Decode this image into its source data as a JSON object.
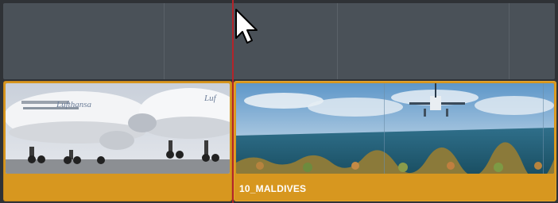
{
  "timeline": {
    "clips": [
      {
        "label": ""
      },
      {
        "label": "10_MALDIVES"
      }
    ]
  },
  "icons": {
    "cursor": "arrow-pointer-icon"
  },
  "colors": {
    "clip_fill": "#d7971f",
    "track_bg": "#4a5158",
    "playhead": "#b3242a"
  }
}
